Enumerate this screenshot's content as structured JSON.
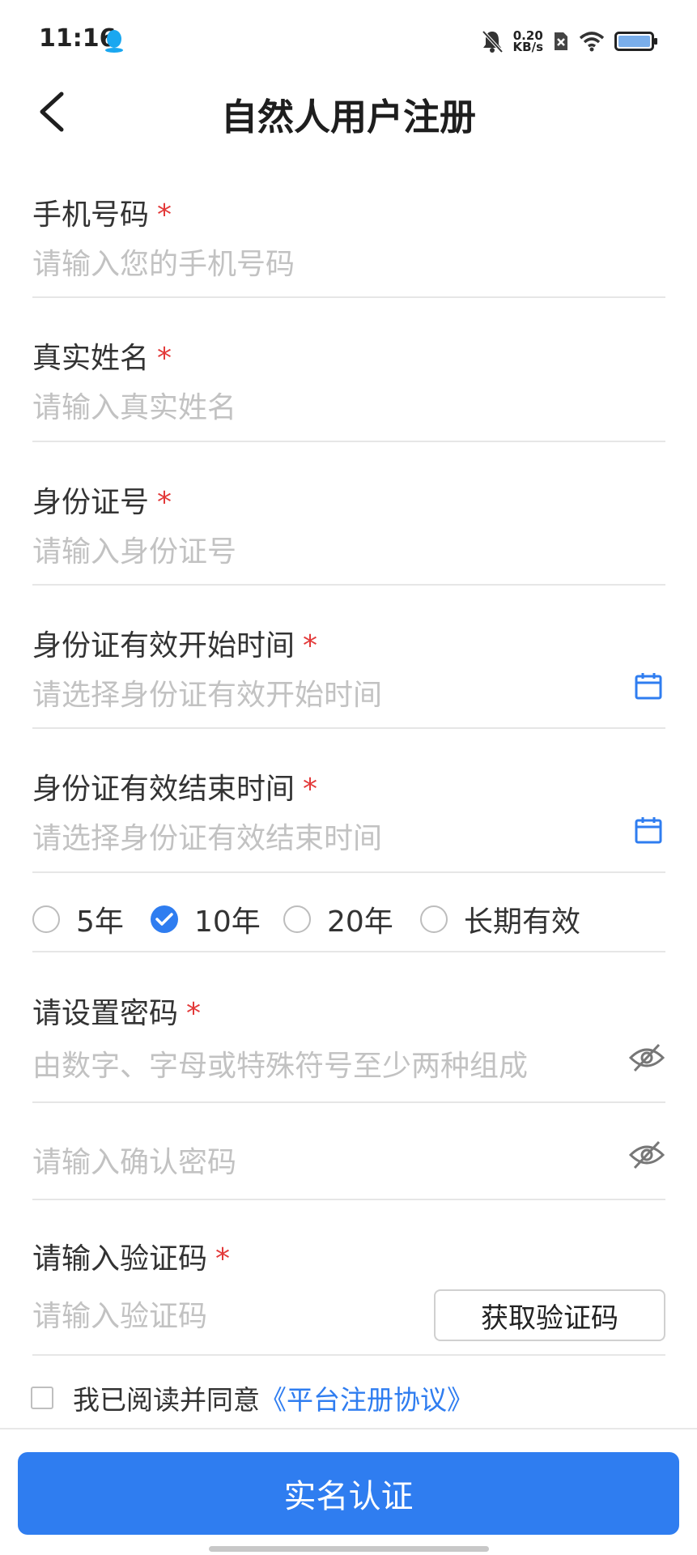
{
  "status_bar": {
    "time": "11:16",
    "net_speed_value": "0.20",
    "net_speed_unit": "KB/s"
  },
  "nav": {
    "title": "自然人用户注册"
  },
  "form": {
    "required_mark": "*",
    "phone": {
      "label": "手机号码",
      "placeholder": "请输入您的手机号码"
    },
    "real_name": {
      "label": "真实姓名",
      "placeholder": "请输入真实姓名"
    },
    "id_number": {
      "label": "身份证号",
      "placeholder": "请输入身份证号"
    },
    "id_valid_start": {
      "label": "身份证有效开始时间",
      "placeholder": "请选择身份证有效开始时间"
    },
    "id_valid_end": {
      "label": "身份证有效结束时间",
      "placeholder": "请选择身份证有效结束时间"
    },
    "validity_options": [
      {
        "label": "5年",
        "checked": false
      },
      {
        "label": "10年",
        "checked": true
      },
      {
        "label": "20年",
        "checked": false
      },
      {
        "label": "长期有效",
        "checked": false
      }
    ],
    "password": {
      "label": "请设置密码",
      "placeholder": "由数字、字母或特殊符号至少两种组成"
    },
    "confirm_password": {
      "placeholder": "请输入确认密码"
    },
    "verify_code": {
      "label": "请输入验证码",
      "placeholder": "请输入验证码",
      "button_label": "获取验证码"
    }
  },
  "agreement": {
    "text": "我已阅读并同意",
    "link": "《平台注册协议》",
    "checked": false
  },
  "submit": {
    "label": "实名认证"
  },
  "colors": {
    "accent": "#2f7df0",
    "required": "#e33a3a",
    "placeholder": "#c2c2c2"
  }
}
